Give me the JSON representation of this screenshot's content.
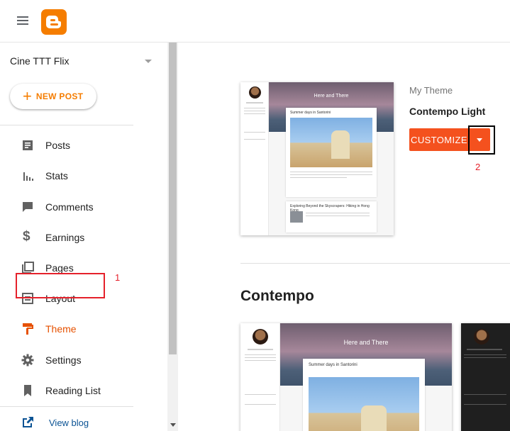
{
  "header": {
    "menu_icon": "hamburger-menu-icon",
    "logo_icon": "blogger-logo-icon"
  },
  "sidebar": {
    "blog_name": "Cine TTT Flix",
    "new_post_label": "NEW POST",
    "items": [
      {
        "label": "Posts",
        "icon": "posts-icon"
      },
      {
        "label": "Stats",
        "icon": "stats-icon"
      },
      {
        "label": "Comments",
        "icon": "comments-icon"
      },
      {
        "label": "Earnings",
        "icon": "dollar-icon"
      },
      {
        "label": "Pages",
        "icon": "pages-icon"
      },
      {
        "label": "Layout",
        "icon": "layout-icon"
      },
      {
        "label": "Theme",
        "icon": "paint-roller-icon",
        "active": true
      },
      {
        "label": "Settings",
        "icon": "gear-icon"
      },
      {
        "label": "Reading List",
        "icon": "bookmark-icon"
      }
    ],
    "view_blog_label": "View blog"
  },
  "annotations": {
    "step1": "1",
    "step2": "2"
  },
  "main": {
    "current_theme": {
      "my_theme_label": "My Theme",
      "theme_name": "Contempo Light",
      "customize_label": "CUSTOMIZE",
      "preview": {
        "header_title": "Here and There",
        "post1_title": "Summer days in Santorini",
        "post2_title": "Exploring Beyond the Skyscrapers: Hiking in Hong Kong"
      }
    },
    "section_title": "Contempo",
    "gallery_preview": {
      "header_title": "Here and There",
      "post_title": "Summer days in Santorini"
    }
  },
  "colors": {
    "accent": "#f57d00",
    "customize_bg": "#f4511e",
    "active_text": "#e65100",
    "annotation_red": "#e5212b"
  }
}
